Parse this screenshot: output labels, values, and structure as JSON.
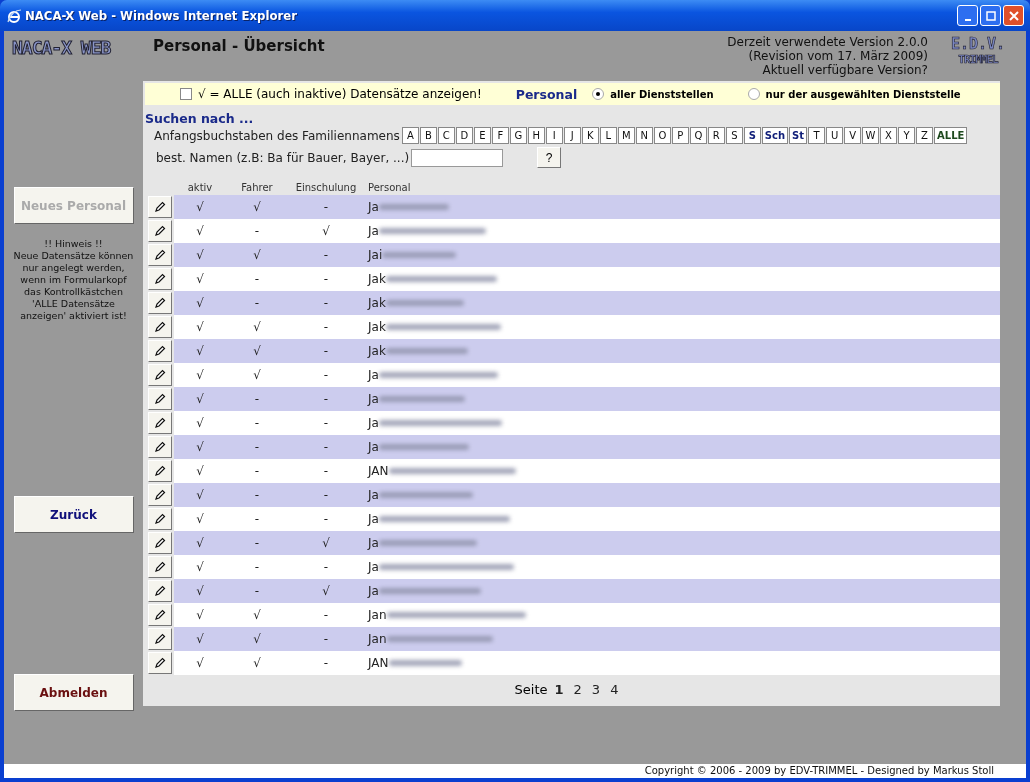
{
  "window": {
    "title": "NACA-X Web - Windows Internet Explorer"
  },
  "header": {
    "logo": "NACA-X WEB",
    "title": "Personal - Übersicht",
    "version_lines": [
      "Derzeit verwendete Version 2.0.0",
      "(Revision vom 17. März 2009)",
      "Aktuell verfügbare Version?"
    ],
    "vendor_logo": [
      "E.D.V.",
      "TRIMMEL"
    ]
  },
  "sidebar": {
    "buttons": [
      {
        "label": "Neues Personal",
        "disabled": true,
        "kind": "plain"
      },
      {
        "label": "Zurück",
        "disabled": false,
        "kind": "navy"
      },
      {
        "label": "Abmelden",
        "disabled": false,
        "kind": "maroon"
      }
    ],
    "hint": [
      "!! Hinweis !!",
      "Neue Datensätze können nur angelegt werden, wenn im Formularkopf das Kontrollkästchen 'ALLE Datensätze anzeigen' aktiviert ist!"
    ]
  },
  "filter": {
    "show_all": {
      "label": "√ = ALLE (auch inaktive) Datensätze anzeigen!",
      "checked": false
    },
    "group_label": "Personal",
    "options": [
      {
        "label": "aller Dienststellen",
        "selected": true
      },
      {
        "label": "nur der ausgewählten Dienststelle",
        "selected": false
      }
    ]
  },
  "search": {
    "title": "Suchen nach ...",
    "letters_label": "Anfangsbuchstaben des Familiennamens",
    "letters": [
      {
        "label": "A",
        "kind": "plain"
      },
      {
        "label": "B",
        "kind": "plain"
      },
      {
        "label": "C",
        "kind": "plain"
      },
      {
        "label": "D",
        "kind": "plain"
      },
      {
        "label": "E",
        "kind": "plain"
      },
      {
        "label": "F",
        "kind": "plain"
      },
      {
        "label": "G",
        "kind": "plain"
      },
      {
        "label": "H",
        "kind": "plain"
      },
      {
        "label": "I",
        "kind": "plain"
      },
      {
        "label": "J",
        "kind": "plain"
      },
      {
        "label": "K",
        "kind": "plain"
      },
      {
        "label": "L",
        "kind": "plain"
      },
      {
        "label": "M",
        "kind": "plain"
      },
      {
        "label": "N",
        "kind": "plain"
      },
      {
        "label": "O",
        "kind": "plain"
      },
      {
        "label": "P",
        "kind": "plain"
      },
      {
        "label": "Q",
        "kind": "plain"
      },
      {
        "label": "R",
        "kind": "plain"
      },
      {
        "label": "S",
        "kind": "plain"
      },
      {
        "label": "S",
        "kind": "special"
      },
      {
        "label": "Sch",
        "kind": "special"
      },
      {
        "label": "St",
        "kind": "special"
      },
      {
        "label": "T",
        "kind": "plain"
      },
      {
        "label": "U",
        "kind": "plain"
      },
      {
        "label": "V",
        "kind": "plain"
      },
      {
        "label": "W",
        "kind": "plain"
      },
      {
        "label": "X",
        "kind": "plain"
      },
      {
        "label": "Y",
        "kind": "plain"
      },
      {
        "label": "Z",
        "kind": "plain"
      },
      {
        "label": "ALLE",
        "kind": "all"
      }
    ],
    "name_label": "best. Namen (z.B: Ba für Bauer, Bayer, ...)",
    "help_button": "?"
  },
  "table": {
    "columns": [
      "aktiv",
      "Fahrer",
      "Einschulung",
      "Personal"
    ],
    "rows": [
      {
        "aktiv": "√",
        "fahrer": "√",
        "einschulung": "-",
        "personal": "Ja"
      },
      {
        "aktiv": "√",
        "fahrer": "-",
        "einschulung": "√",
        "personal": "Ja"
      },
      {
        "aktiv": "√",
        "fahrer": "√",
        "einschulung": "-",
        "personal": "Jai"
      },
      {
        "aktiv": "√",
        "fahrer": "-",
        "einschulung": "-",
        "personal": "Jak"
      },
      {
        "aktiv": "√",
        "fahrer": "-",
        "einschulung": "-",
        "personal": "Jak"
      },
      {
        "aktiv": "√",
        "fahrer": "√",
        "einschulung": "-",
        "personal": "Jak"
      },
      {
        "aktiv": "√",
        "fahrer": "√",
        "einschulung": "-",
        "personal": "Jak"
      },
      {
        "aktiv": "√",
        "fahrer": "√",
        "einschulung": "-",
        "personal": "Ja"
      },
      {
        "aktiv": "√",
        "fahrer": "-",
        "einschulung": "-",
        "personal": "Ja"
      },
      {
        "aktiv": "√",
        "fahrer": "-",
        "einschulung": "-",
        "personal": "Ja"
      },
      {
        "aktiv": "√",
        "fahrer": "-",
        "einschulung": "-",
        "personal": "Ja"
      },
      {
        "aktiv": "√",
        "fahrer": "-",
        "einschulung": "-",
        "personal": "JAN"
      },
      {
        "aktiv": "√",
        "fahrer": "-",
        "einschulung": "-",
        "personal": "Ja"
      },
      {
        "aktiv": "√",
        "fahrer": "-",
        "einschulung": "-",
        "personal": "Ja"
      },
      {
        "aktiv": "√",
        "fahrer": "-",
        "einschulung": "√",
        "personal": "Ja"
      },
      {
        "aktiv": "√",
        "fahrer": "-",
        "einschulung": "-",
        "personal": "Ja"
      },
      {
        "aktiv": "√",
        "fahrer": "-",
        "einschulung": "√",
        "personal": "Ja"
      },
      {
        "aktiv": "√",
        "fahrer": "√",
        "einschulung": "-",
        "personal": "Jan"
      },
      {
        "aktiv": "√",
        "fahrer": "√",
        "einschulung": "-",
        "personal": "Jan"
      },
      {
        "aktiv": "√",
        "fahrer": "√",
        "einschulung": "-",
        "personal": "JAN"
      }
    ]
  },
  "pagination": {
    "label": "Seite",
    "pages": [
      {
        "label": "1",
        "selected": true
      },
      {
        "label": "2",
        "selected": false
      },
      {
        "label": "3",
        "selected": false
      },
      {
        "label": "4",
        "selected": false
      }
    ]
  },
  "footer": "Copyright © 2006 - 2009 by EDV-TRIMMEL - Designed by Markus Stoll"
}
